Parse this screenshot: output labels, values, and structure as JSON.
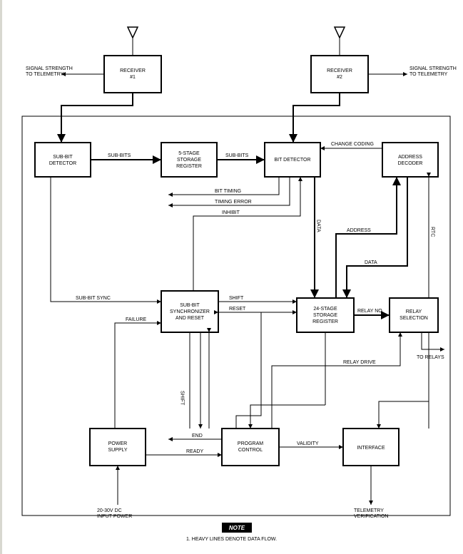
{
  "blocks": {
    "receiver1": "RECEIVER\n#1",
    "receiver2": "RECEIVER\n#2",
    "subbit_detector": "SUB-BIT\nDETECTOR",
    "five_stage": "5-STAGE\nSTORAGE\nREGISTER",
    "bit_detector": "BIT DETECTOR",
    "address_decoder": "ADDRESS\nDECODER",
    "subbit_sync": "SUB-BIT\nSYNCHRONIZER\nAND RESET",
    "twentyfour_stage": "24-STAGE\nSTORAGE\nREGISTER",
    "relay_selection": "RELAY\nSELECTION",
    "power_supply": "POWER\nSUPPLY",
    "program_control": "PROGRAM\nCONTROL",
    "interface": "INTERFACE"
  },
  "signals": {
    "signal_strength_left": "SIGNAL STRENGTH\nTO TELEMETRY",
    "signal_strength_right": "SIGNAL STRENGTH\nTO TELEMETRY",
    "sub_bits_1": "SUB-BITS",
    "sub_bits_2": "SUB-BITS",
    "change_coding": "CHANGE CODING",
    "bit_timing": "BIT TIMING",
    "timing_error": "TIMING ERROR",
    "inhibit": "INHIBIT",
    "data_v": "DATA",
    "address": "ADDRESS",
    "rtc": "RTC",
    "data_h": "DATA",
    "sub_bit_sync": "SUB-BIT SYNC",
    "shift_top": "SHIFT",
    "reset": "RESET",
    "relay_no": "RELAY NO.",
    "failure": "FAILURE",
    "relay_drive": "RELAY DRIVE",
    "to_relays": "TO RELAYS",
    "shift_v": "SHIFT",
    "end": "END",
    "ready": "READY",
    "validity": "VALIDITY",
    "input_power": "20-30V DC\nINPUT POWER",
    "telemetry_verify": "TELEMETRY\nVERIFICATION"
  },
  "note": {
    "badge": "NOTE",
    "text": "1.  HEAVY LINES DENOTE DATA FLOW."
  }
}
